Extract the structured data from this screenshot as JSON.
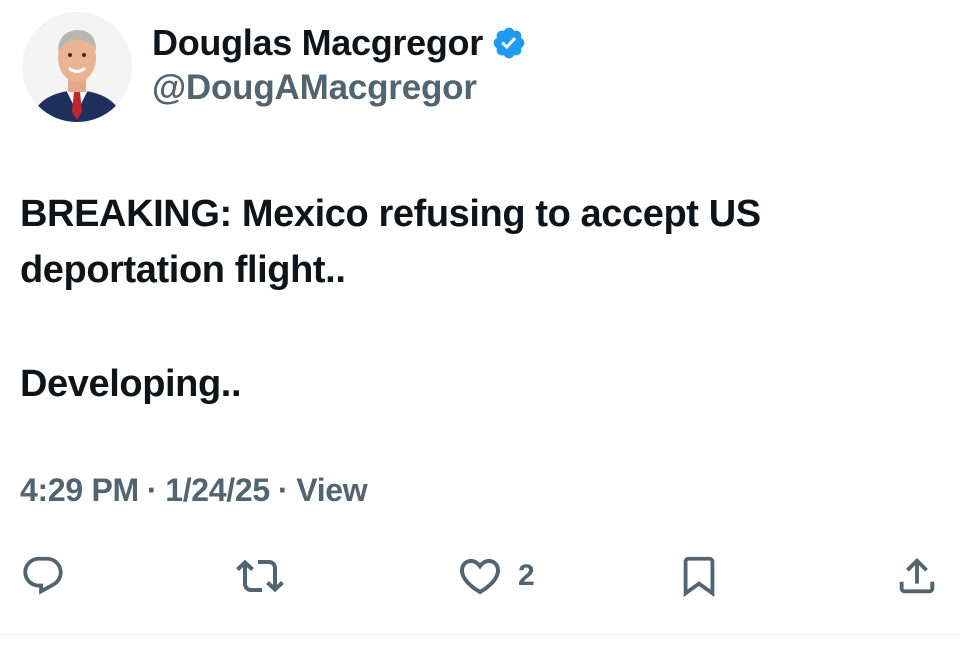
{
  "author": {
    "display_name": "Douglas Macgregor",
    "handle": "@DougAMacgregor",
    "verified": true,
    "verified_color": "#1d9bf0"
  },
  "tweet": {
    "lines": [
      "BREAKING: Mexico refusing to accept US deportation flight..",
      "Developing.."
    ]
  },
  "meta": {
    "time": "4:29 PM",
    "separator": "·",
    "date": "1/24/25",
    "views_label": "View"
  },
  "actions": {
    "reply": {
      "icon": "reply-icon",
      "count": ""
    },
    "retweet": {
      "icon": "retweet-icon",
      "count": ""
    },
    "like": {
      "icon": "heart-icon",
      "count": "2"
    },
    "bookmark": {
      "icon": "bookmark-icon",
      "count": ""
    },
    "share": {
      "icon": "share-icon",
      "count": ""
    }
  },
  "colors": {
    "text": "#0f1419",
    "secondary": "#536471",
    "accent": "#1d9bf0"
  }
}
